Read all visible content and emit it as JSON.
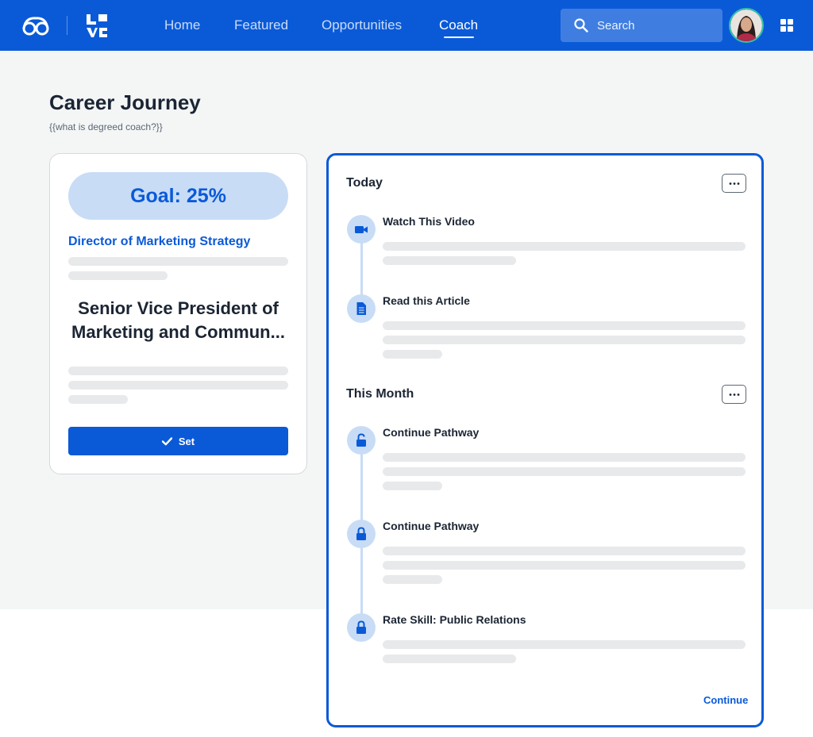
{
  "nav": {
    "items": [
      {
        "label": "Home",
        "active": false
      },
      {
        "label": "Featured",
        "active": false
      },
      {
        "label": "Opportunities",
        "active": false
      },
      {
        "label": "Coach",
        "active": true
      }
    ],
    "search_placeholder": "Search"
  },
  "page": {
    "title": "Career Journey",
    "subtitle": "{{what is degreed coach?}}"
  },
  "goal_card": {
    "goal_label": "Goal: 25%",
    "target_role": "Director of Marketing Strategy",
    "current_role": "Senior Vice President of Marketing and Commun...",
    "set_label": "Set"
  },
  "journey": {
    "sections": [
      {
        "heading": "Today",
        "steps": [
          {
            "title": "Watch This Video",
            "icon": "video-icon"
          },
          {
            "title": "Read this Article",
            "icon": "article-icon"
          }
        ]
      },
      {
        "heading": "This Month",
        "steps": [
          {
            "title": "Continue Pathway",
            "icon": "unlocked-icon"
          },
          {
            "title": "Continue Pathway",
            "icon": "lock-icon"
          },
          {
            "title": "Rate Skill: Public Relations",
            "icon": "lock-icon"
          }
        ]
      }
    ],
    "continue_label": "Continue"
  },
  "colors": {
    "brand": "#0a5ad8",
    "light_blue": "#c8dcf6",
    "page_bg": "#f4f6f6",
    "skeleton": "#e7e9eb",
    "text": "#1b2533"
  }
}
